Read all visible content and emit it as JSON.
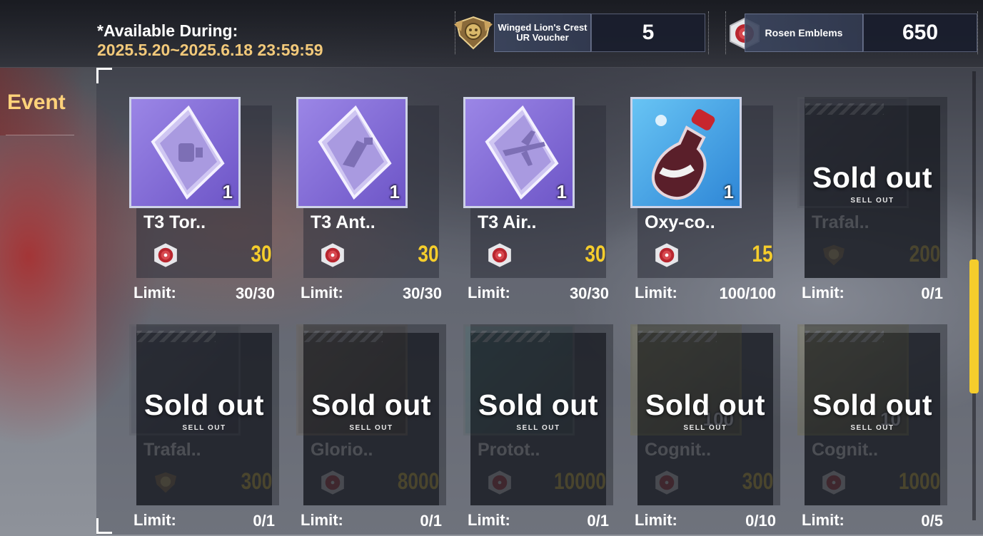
{
  "header": {
    "available_label": "*Available During:",
    "available_dates": "2025.5.20~2025.6.18 23:59:59"
  },
  "currencies": [
    {
      "label": "Winged Lion's Crest UR Voucher",
      "value": "5",
      "icon": "winged-lion-crest-icon"
    },
    {
      "label": "Rosen Emblems",
      "value": "650",
      "icon": "rosen-emblem-icon"
    }
  ],
  "sidebar": {
    "tab_label": "Event"
  },
  "shop": {
    "limit_label": "Limit:",
    "sold_out_label": "Sold out",
    "sell_out_label": "SELL OUT",
    "items": [
      {
        "name": "T3 Tor..",
        "qty": "1",
        "price": "30",
        "limit": "30/30",
        "sold_out": false,
        "icon": "torpedo-part-book-icon"
      },
      {
        "name": "T3 Ant..",
        "qty": "1",
        "price": "30",
        "limit": "30/30",
        "sold_out": false,
        "icon": "anti-air-part-book-icon"
      },
      {
        "name": "T3 Air..",
        "qty": "1",
        "price": "30",
        "limit": "30/30",
        "sold_out": false,
        "icon": "aircraft-part-book-icon"
      },
      {
        "name": "Oxy-co..",
        "qty": "1",
        "price": "15",
        "limit": "100/100",
        "sold_out": false,
        "icon": "oxy-cola-bottle-icon"
      },
      {
        "name": "Trafal..",
        "qty": "",
        "price": "200",
        "limit": "0/1",
        "sold_out": true,
        "icon": "character-portrait-icon"
      },
      {
        "name": "Trafal..",
        "qty": "",
        "price": "300",
        "limit": "0/1",
        "sold_out": true,
        "icon": "character-portrait-icon"
      },
      {
        "name": "Glorio..",
        "qty": "",
        "price": "8000",
        "limit": "0/1",
        "sold_out": true,
        "icon": "character-portrait-icon"
      },
      {
        "name": "Protot..",
        "qty": "",
        "price": "10000",
        "limit": "0/1",
        "sold_out": true,
        "icon": "gun-turret-icon"
      },
      {
        "name": "Cognit..",
        "qty": "100",
        "price": "300",
        "limit": "0/10",
        "sold_out": true,
        "icon": "cognitive-chip-icon"
      },
      {
        "name": "Cognit..",
        "qty": "10",
        "price": "1000",
        "limit": "0/5",
        "sold_out": true,
        "icon": "cognitive-chip-icon"
      }
    ]
  },
  "colors": {
    "price": "#f5cd2c",
    "date": "#f2c97a",
    "event_tab": "#ffd27a",
    "scrollbar": "#f5cd2c",
    "item_purple": "#8a6fd8",
    "item_blue": "#3aa2e6"
  }
}
